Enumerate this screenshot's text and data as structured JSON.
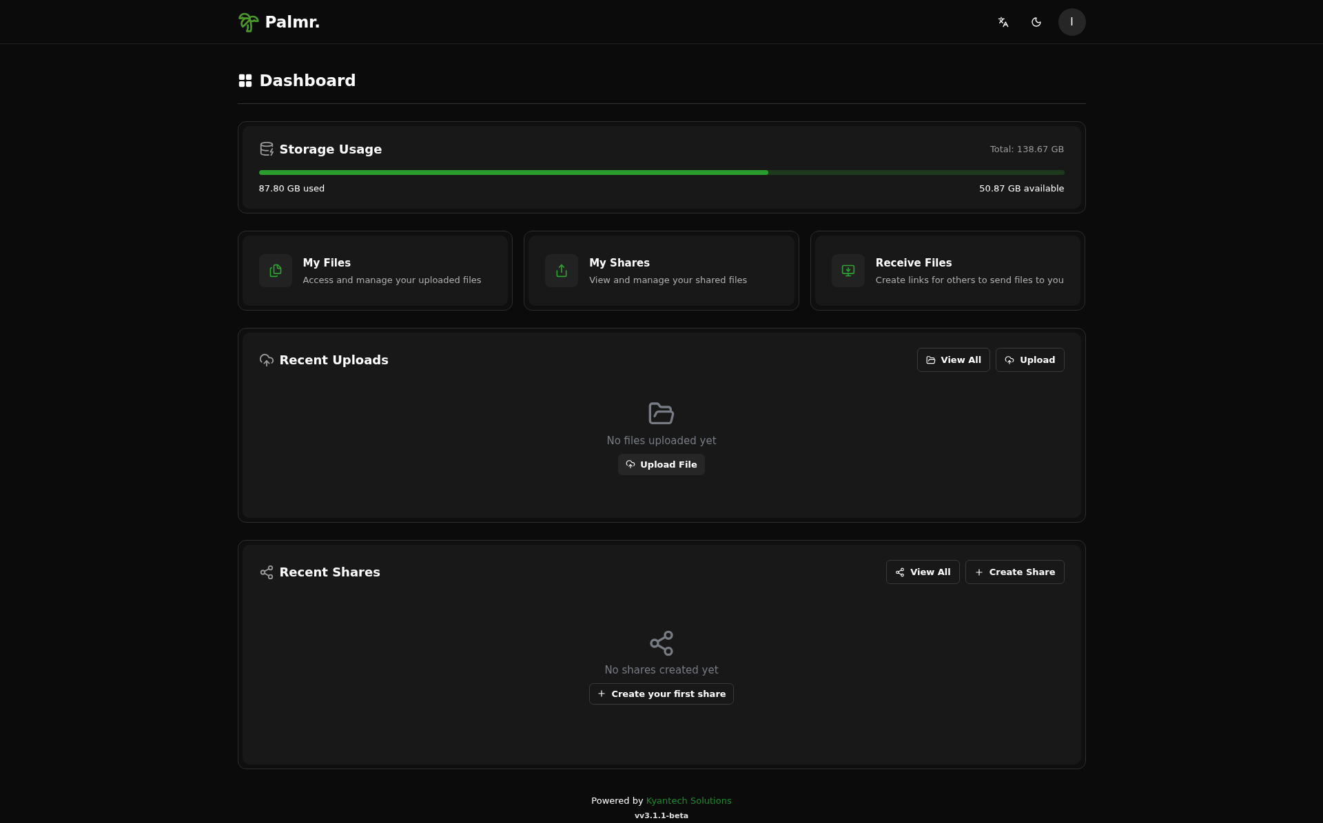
{
  "header": {
    "brand": "Palmr.",
    "avatar_initial": "I"
  },
  "page": {
    "title": "Dashboard"
  },
  "storage": {
    "title": "Storage Usage",
    "total": "Total: 138.67 GB",
    "level": 0.633,
    "used": "87.80 GB used",
    "available": "50.87 GB available"
  },
  "quick_actions": [
    {
      "kind": "files",
      "title": "My Files",
      "description": "Access and manage your uploaded files"
    },
    {
      "kind": "shares",
      "title": "My Shares",
      "description": "View and manage your shared files"
    },
    {
      "kind": "receive",
      "title": "Receive Files",
      "description": "Create links for others to send files to you"
    }
  ],
  "sections": [
    {
      "kind": "uploads",
      "title": "Recent Uploads",
      "buttons": [
        {
          "kind": "folder",
          "label": "View All"
        },
        {
          "kind": "upload",
          "label": "Upload"
        }
      ],
      "empty_text": "No files uploaded yet",
      "empty_button": {
        "kind": "upload",
        "label": "Upload File"
      }
    },
    {
      "kind": "shares",
      "title": "Recent Shares",
      "buttons": [
        {
          "kind": "share",
          "label": "View All"
        },
        {
          "kind": "plus",
          "label": "Create Share"
        }
      ],
      "empty_text": "No shares created yet",
      "empty_button": {
        "kind": "plus",
        "label": "Create your first share"
      }
    }
  ],
  "footer": {
    "powered_by": "Powered by",
    "company": "Kyantech Solutions",
    "version": "vv3.1.1-beta"
  }
}
